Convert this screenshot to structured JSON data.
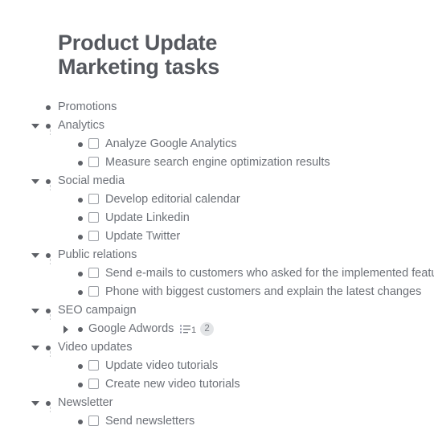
{
  "document": {
    "title": "Product Update\nMarketing tasks"
  },
  "outline": [
    {
      "label": "Promotions",
      "level": 1,
      "twisty": "none",
      "checkbox": false,
      "guide": false
    },
    {
      "label": "Analytics",
      "level": 1,
      "twisty": "down",
      "checkbox": false,
      "guide": true
    },
    {
      "label": "Analyze Google Analytics",
      "level": 2,
      "twisty": "none",
      "checkbox": true,
      "checked": false
    },
    {
      "label": "Measure search engine optimization results",
      "level": 2,
      "twisty": "none",
      "checkbox": true,
      "checked": false
    },
    {
      "label": "Social media",
      "level": 1,
      "twisty": "down",
      "checkbox": false,
      "guide": true
    },
    {
      "label": "Develop editorial calendar",
      "level": 2,
      "twisty": "none",
      "checkbox": true,
      "checked": false
    },
    {
      "label": "Update Linkedin",
      "level": 2,
      "twisty": "none",
      "checkbox": true,
      "checked": false
    },
    {
      "label": "Update Twitter",
      "level": 2,
      "twisty": "none",
      "checkbox": true,
      "checked": false
    },
    {
      "label": "Public relations",
      "level": 1,
      "twisty": "down",
      "checkbox": false,
      "guide": true
    },
    {
      "label": "Send e-mails to customers who asked for the implemented features",
      "level": 2,
      "twisty": "none",
      "checkbox": true,
      "checked": false
    },
    {
      "label": "Phone with biggest customers and explain the latest changes",
      "level": 2,
      "twisty": "none",
      "checkbox": true,
      "checked": false
    },
    {
      "label": "SEO campaign",
      "level": 1,
      "twisty": "down",
      "checkbox": false,
      "guide": true
    },
    {
      "label": "Google Adwords",
      "level": 2,
      "twisty": "right",
      "checkbox": false,
      "meta": {
        "list_icon": "checklist-icon",
        "list_count": "1",
        "badge": "2"
      }
    },
    {
      "label": "Video updates",
      "level": 1,
      "twisty": "down",
      "checkbox": false,
      "guide": true
    },
    {
      "label": "Update video tutorials",
      "level": 2,
      "twisty": "none",
      "checkbox": true,
      "checked": false
    },
    {
      "label": "Create new video tutorials",
      "level": 2,
      "twisty": "none",
      "checkbox": true,
      "checked": false
    },
    {
      "label": "Newsletter",
      "level": 1,
      "twisty": "down",
      "checkbox": false,
      "guide": true
    },
    {
      "label": "Send newsletters",
      "level": 2,
      "twisty": "none",
      "checkbox": true,
      "checked": false
    }
  ],
  "colors": {
    "title": "#55585e",
    "text": "#6d7178",
    "bullet": "#5d6066",
    "checkbox_border": "#9a9ea4",
    "guide_line": "#c9cbce",
    "badge_bg": "#e3e5e7",
    "background": "#ffffff"
  }
}
